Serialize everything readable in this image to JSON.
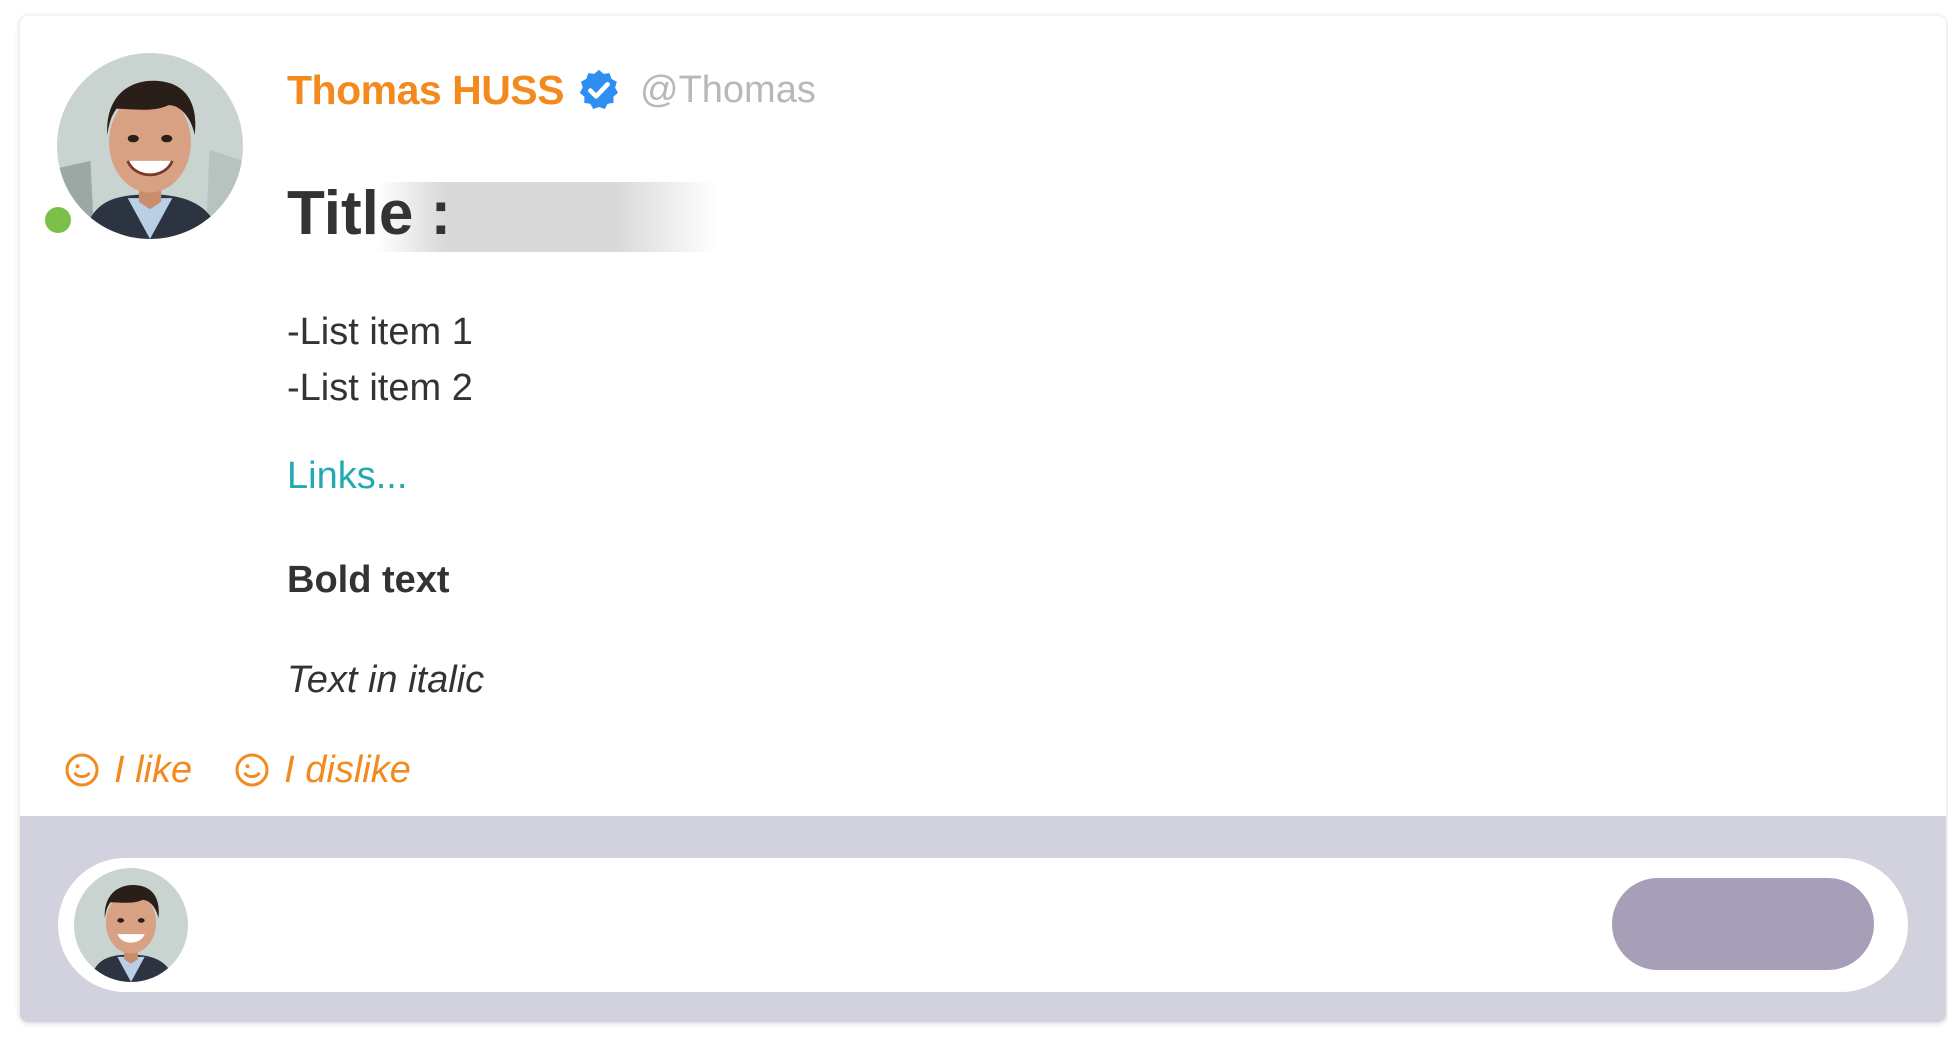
{
  "author": {
    "name": "Thomas HUSS",
    "handle": "@Thomas",
    "verified": true,
    "online": true
  },
  "post": {
    "title": "Title :",
    "list_items": [
      "-List item 1",
      "-List item 2"
    ],
    "link_text": "Links...",
    "bold_text": "Bold text",
    "italic_text": "Text in italic"
  },
  "reactions": {
    "like_label": "I like",
    "dislike_label": "I dislike"
  },
  "comment": {
    "send_label": ""
  },
  "colors": {
    "accent": "#f28a1e",
    "link": "#22aab0",
    "verified": "#2f8ef2",
    "online": "#7cc04b",
    "comment_bar": "#d2d1de",
    "send_button": "#a79fb8"
  },
  "icons": {
    "verified": "verified-badge-icon",
    "reaction": "smiley-icon"
  }
}
